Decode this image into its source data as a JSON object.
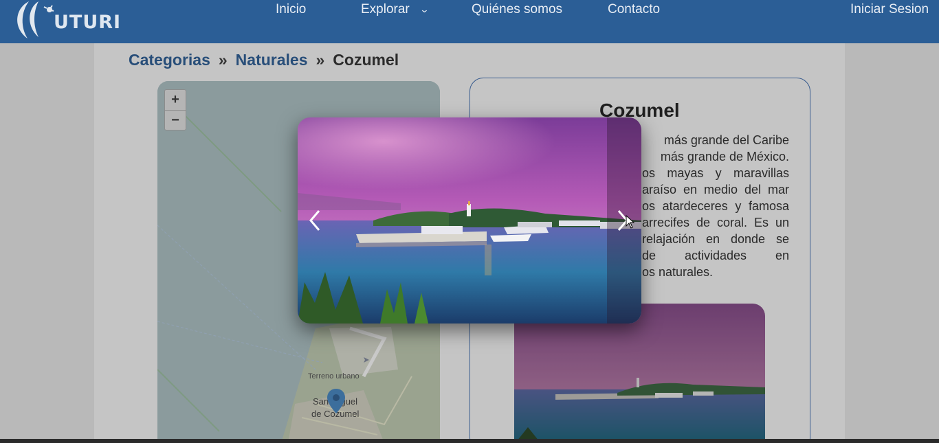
{
  "header": {
    "logo_text": "UTURI",
    "nav": {
      "home": "Inicio",
      "explore": "Explorar",
      "about": "Quiénes somos",
      "contact": "Contacto",
      "login": "Iniciar Sesion"
    }
  },
  "breadcrumb": {
    "level1": "Categorias",
    "sep1": "»",
    "level2": "Naturales",
    "sep2": "»",
    "current": "Cozumel"
  },
  "map": {
    "zoom_in": "+",
    "zoom_out": "−",
    "label_urban": "Terreno urbano",
    "label_town_1": "San Miguel",
    "label_town_2": "de Cozumel"
  },
  "card": {
    "title": "Cozumel",
    "description_lines": [
      "más grande del Caribe",
      "más grande de México.",
      "os mayas y maravillas",
      "araíso en medio del mar",
      "os atardeceres y famosa",
      "arrecifes de coral. Es un",
      "relajación en donde se",
      "de actividades en",
      "os naturales."
    ]
  },
  "lightbox": {
    "prev_icon": "chevron-left-icon",
    "next_icon": "chevron-right-icon"
  },
  "colors": {
    "navbar": "#2b5e96",
    "link": "#284e79",
    "card_border": "#3a5d8f"
  }
}
